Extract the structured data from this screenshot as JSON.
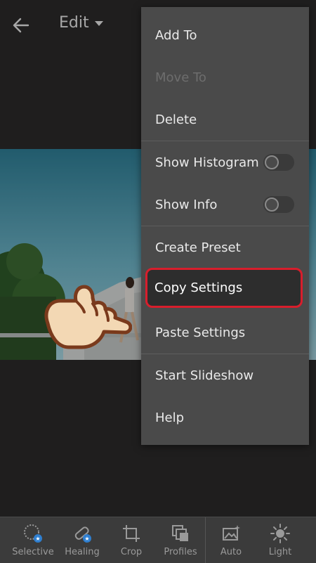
{
  "header": {
    "title": "Edit"
  },
  "menu": {
    "items": [
      {
        "label": "Add To",
        "enabled": true
      },
      {
        "label": "Move To",
        "enabled": false
      },
      {
        "label": "Delete",
        "enabled": true
      },
      {
        "label": "Show Histogram",
        "toggle": false
      },
      {
        "label": "Show Info",
        "toggle": false
      },
      {
        "label": "Create Preset",
        "enabled": true
      },
      {
        "label": "Copy Settings",
        "enabled": true,
        "highlighted": true
      },
      {
        "label": "Paste Settings",
        "enabled": true
      },
      {
        "label": "Start Slideshow",
        "enabled": true
      },
      {
        "label": "Help",
        "enabled": true
      }
    ]
  },
  "toolbar": {
    "items": [
      {
        "label": "Selective",
        "icon": "selective-icon"
      },
      {
        "label": "Healing",
        "icon": "healing-icon"
      },
      {
        "label": "Crop",
        "icon": "crop-icon"
      },
      {
        "label": "Profiles",
        "icon": "profiles-icon"
      },
      {
        "label": "Auto",
        "icon": "auto-icon"
      },
      {
        "label": "Light",
        "icon": "light-icon"
      }
    ]
  },
  "colors": {
    "highlight": "#d81e2c",
    "menu_bg": "#4a4a4a",
    "app_bg": "#2b2a2a"
  }
}
